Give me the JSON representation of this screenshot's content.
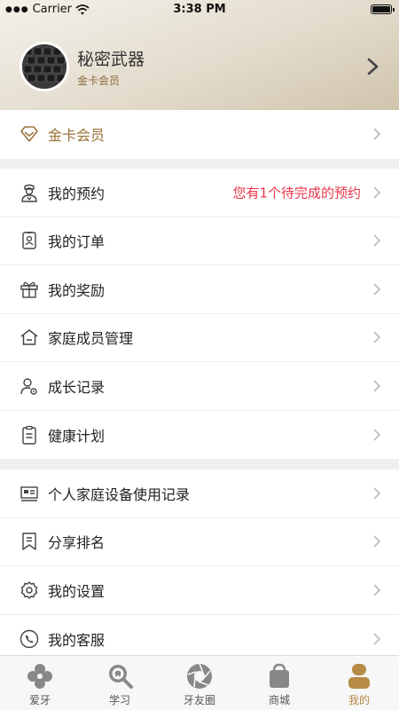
{
  "status_bar": {
    "carrier": "Carrier",
    "time": "3:38 PM"
  },
  "profile": {
    "name": "秘密武器",
    "level": "金卡会员"
  },
  "membership": {
    "label": "金卡会员"
  },
  "section_main": [
    {
      "key": "appointment",
      "label": "我的预约",
      "note": "您有1个待完成的预约"
    },
    {
      "key": "orders",
      "label": "我的订单"
    },
    {
      "key": "rewards",
      "label": "我的奖励"
    },
    {
      "key": "family",
      "label": "家庭成员管理"
    },
    {
      "key": "growth",
      "label": "成长记录"
    },
    {
      "key": "health",
      "label": "健康计划"
    }
  ],
  "section_more": [
    {
      "key": "device",
      "label": "个人家庭设备使用记录"
    },
    {
      "key": "share",
      "label": "分享排名"
    },
    {
      "key": "settings",
      "label": "我的设置"
    },
    {
      "key": "service",
      "label": "我的客服"
    }
  ],
  "tabs": [
    {
      "key": "aiya",
      "label": "爱牙",
      "active": false
    },
    {
      "key": "learn",
      "label": "学习",
      "active": false
    },
    {
      "key": "circle",
      "label": "牙友圈",
      "active": false
    },
    {
      "key": "mall",
      "label": "商城",
      "active": false
    },
    {
      "key": "mine",
      "label": "我的",
      "active": true
    }
  ],
  "colors": {
    "accent_gold": "#b78a45",
    "alert_red": "#e8344a"
  }
}
